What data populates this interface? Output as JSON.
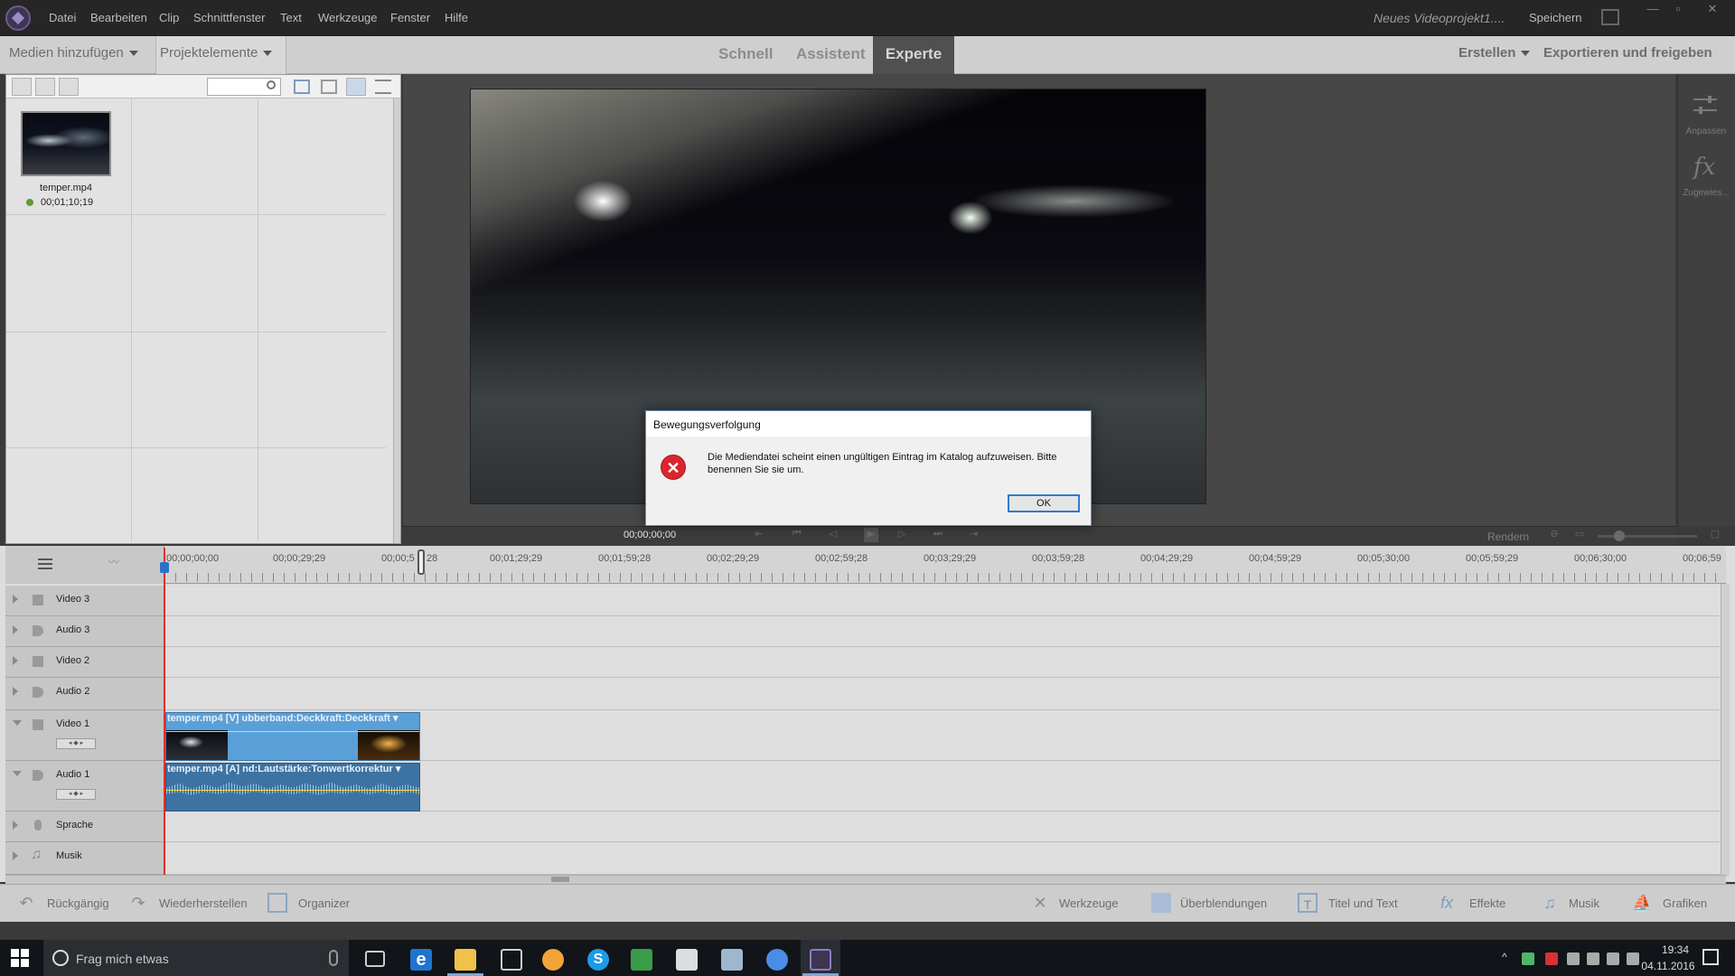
{
  "menu": {
    "items": [
      "Datei",
      "Bearbeiten",
      "Clip",
      "Schnittfenster",
      "Text",
      "Werkzeuge",
      "Fenster",
      "Hilfe"
    ],
    "project_title": "Neues Videoprojekt1....",
    "save": "Speichern"
  },
  "topbar": {
    "add_media": "Medien hinzufügen",
    "project_elements": "Projektelemente",
    "modes": [
      "Schnell",
      "Assistent",
      "Experte"
    ],
    "active_mode": "Experte",
    "create": "Erstellen",
    "export": "Exportieren und freigeben"
  },
  "media": {
    "items": [
      {
        "name": "temper.mp4",
        "duration": "00;01;10;19"
      }
    ]
  },
  "monitor": {
    "timecode": "00;00;00;00",
    "render": "Rendern"
  },
  "right_panel": {
    "adjust": "Anpassen",
    "applied": "Zugewies..."
  },
  "timeline": {
    "ruler": [
      "00;00;00;00",
      "00;00;29;29",
      "00;00;5",
      "28",
      "00;01;29;29",
      "00;01;59;28",
      "00;02;29;29",
      "00;02;59;28",
      "00;03;29;29",
      "00;03;59;28",
      "00;04;29;29",
      "00;04;59;29",
      "00;05;30;00",
      "00;05;59;29",
      "00;06;30;00",
      "00;06;59"
    ],
    "tracks": [
      {
        "name": "Video 3",
        "kind": "video"
      },
      {
        "name": "Audio 3",
        "kind": "audio"
      },
      {
        "name": "Video 2",
        "kind": "video"
      },
      {
        "name": "Audio 2",
        "kind": "audio"
      },
      {
        "name": "Video 1",
        "kind": "video"
      },
      {
        "name": "Audio 1",
        "kind": "audio"
      },
      {
        "name": "Sprache",
        "kind": "voice"
      },
      {
        "name": "Musik",
        "kind": "music"
      }
    ],
    "video_clip_label": "temper.mp4 [V] ubberband:Deckkraft:Deckkraft ▾",
    "audio_clip_label": "temper.mp4 [A] nd:Lautstärke:Tonwertkorrektur ▾"
  },
  "bottombar": {
    "undo": "Rückgängig",
    "redo": "Wiederherstellen",
    "organizer": "Organizer",
    "tools": "Werkzeuge",
    "transitions": "Überblendungen",
    "titles": "Titel und Text",
    "effects": "Effekte",
    "music": "Musik",
    "graphics": "Grafiken"
  },
  "dialog": {
    "title": "Bewegungsverfolgung",
    "message": "Die Mediendatei scheint einen ungültigen Eintrag im Katalog aufzuweisen. Bitte benennen Sie sie um.",
    "ok": "OK"
  },
  "taskbar": {
    "search_placeholder": "Frag mich etwas",
    "time": "19:34",
    "date": "04.11.2016"
  }
}
